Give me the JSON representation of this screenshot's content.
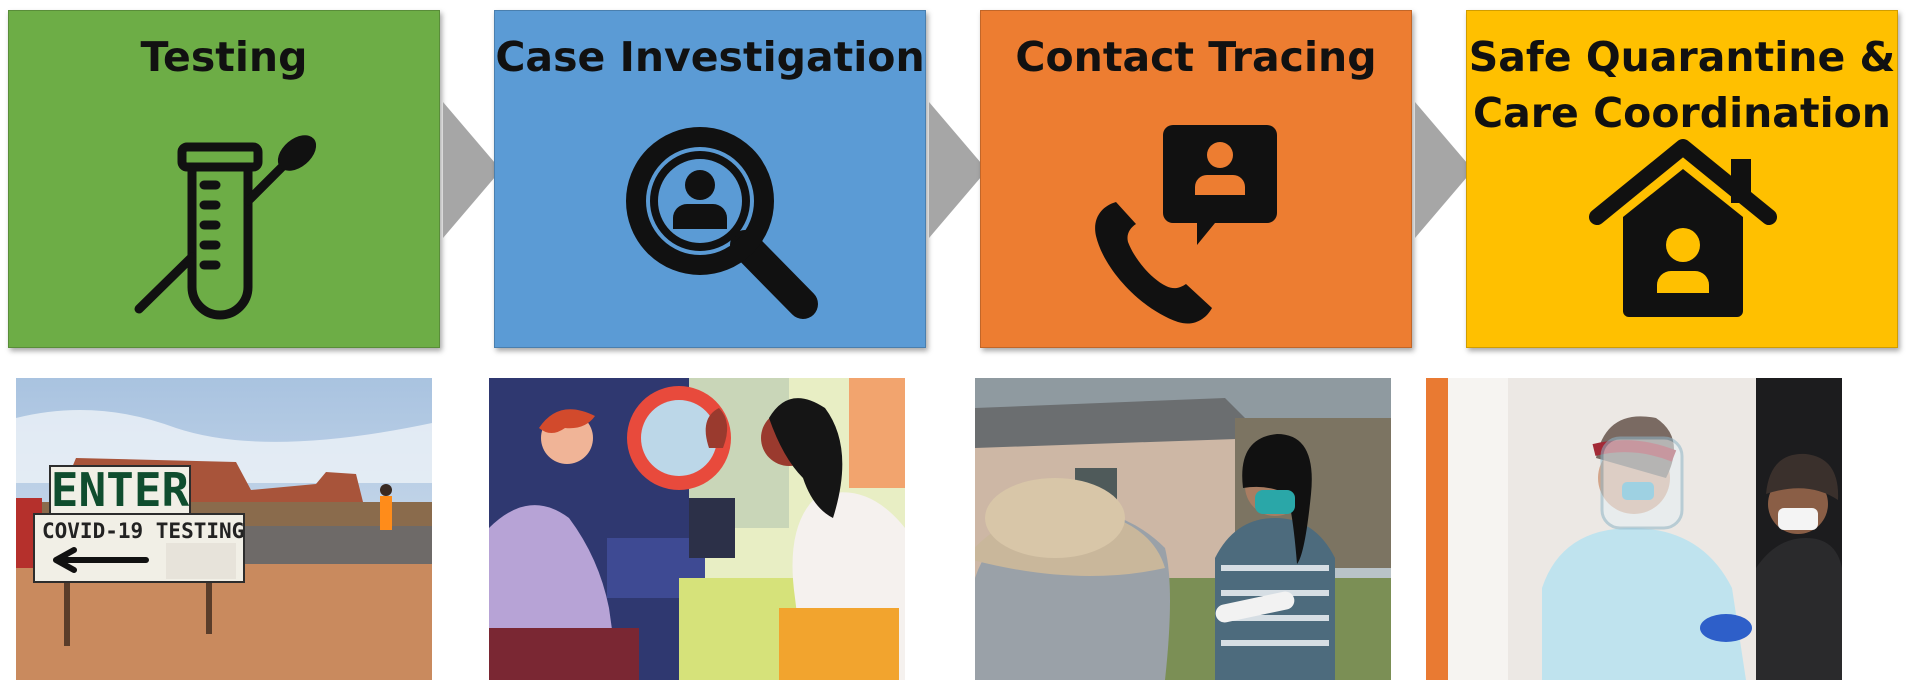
{
  "stages": [
    {
      "title_lines": [
        "Testing"
      ],
      "color": "#6DAD46",
      "icon": "test-tube-swab-icon"
    },
    {
      "title_lines": [
        "Case Investigation"
      ],
      "color": "#5B9BD5",
      "icon": "magnifier-person-icon"
    },
    {
      "title_lines": [
        "Contact Tracing"
      ],
      "color": "#ED7D31",
      "icon": "phone-chat-person-icon"
    },
    {
      "title_lines": [
        "Safe Quarantine &",
        "Care Coordination"
      ],
      "color": "#FFC000",
      "icon": "house-person-icon"
    }
  ],
  "arrow_color": "#A6A6A6",
  "photos": [
    {
      "subject": "testing-site-sign-photo",
      "sign": {
        "enter": "ENTER",
        "covid": "COVID-19 TESTING"
      }
    },
    {
      "subject": "case-investigation-illustration"
    },
    {
      "subject": "contact-tracer-photo"
    },
    {
      "subject": "care-worker-photo"
    }
  ]
}
